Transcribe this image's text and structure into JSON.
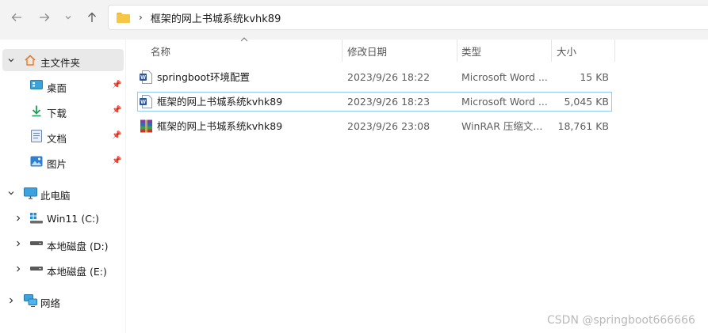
{
  "address_bar": {
    "path": "框架的网上书城系统kvhk89",
    "separator": "›"
  },
  "nav_pane": {
    "home": "主文件夹",
    "quick_access": [
      "桌面",
      "下载",
      "文档",
      "图片"
    ],
    "this_pc": "此电脑",
    "drives": [
      "Win11 (C:)",
      "本地磁盘 (D:)",
      "本地磁盘 (E:)"
    ],
    "network": "网络"
  },
  "columns": {
    "name": "名称",
    "date": "修改日期",
    "type": "类型",
    "size": "大小"
  },
  "files": [
    {
      "name": "springboot环境配置",
      "date": "2023/9/26 18:22",
      "type": "Microsoft Word ...",
      "size": "15 KB",
      "icon": "word-doc-icon"
    },
    {
      "name": "框架的网上书城系统kvhk89",
      "date": "2023/9/26 18:23",
      "type": "Microsoft Word ...",
      "size": "5,045 KB",
      "icon": "word-doc-icon"
    },
    {
      "name": "框架的网上书城系统kvhk89",
      "date": "2023/9/26 23:08",
      "type": "WinRAR 压缩文...",
      "size": "18,761 KB",
      "icon": "winrar-archive-icon"
    }
  ],
  "watermark": "CSDN @springboot666666",
  "colors": {
    "accent": "#0067c0",
    "folder": "#f6c744",
    "selection_border": "#90c8f6",
    "word": "#2b579a"
  }
}
